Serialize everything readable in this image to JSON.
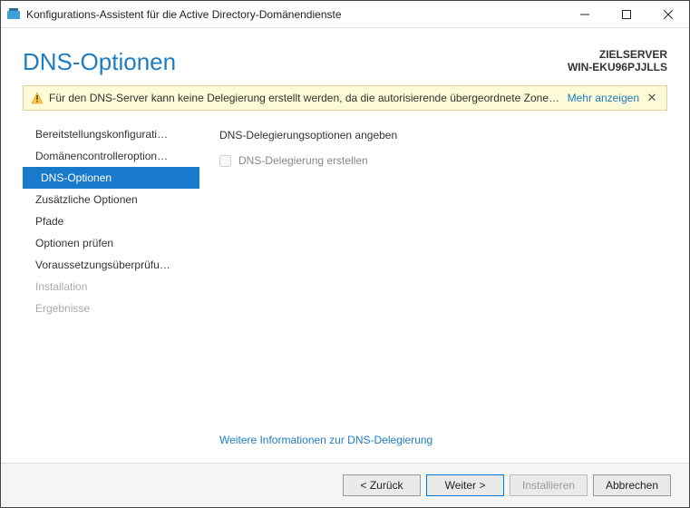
{
  "window": {
    "title": "Konfigurations-Assistent für die Active Directory-Domänendienste"
  },
  "header": {
    "page_title": "DNS-Optionen",
    "target_label": "ZIELSERVER",
    "target_name": "WIN-EKU96PJJLLS"
  },
  "warning": {
    "message": "Für den DNS-Server kann keine Delegierung erstellt werden, da die autorisierende übergeordnete Zone…",
    "more": "Mehr anzeigen"
  },
  "nav": {
    "items": [
      {
        "label": "Bereitstellungskonfigurati…",
        "state": "normal"
      },
      {
        "label": "Domänencontrolleroption…",
        "state": "normal"
      },
      {
        "label": "DNS-Optionen",
        "state": "selected"
      },
      {
        "label": "Zusätzliche Optionen",
        "state": "normal"
      },
      {
        "label": "Pfade",
        "state": "normal"
      },
      {
        "label": "Optionen prüfen",
        "state": "normal"
      },
      {
        "label": "Voraussetzungsüberprüfu…",
        "state": "normal"
      },
      {
        "label": "Installation",
        "state": "disabled"
      },
      {
        "label": "Ergebnisse",
        "state": "disabled"
      }
    ]
  },
  "content": {
    "section_title": "DNS-Delegierungsoptionen angeben",
    "checkbox_label": "DNS-Delegierung erstellen",
    "checkbox_checked": false,
    "more_link": "Weitere Informationen zur DNS-Delegierung"
  },
  "footer": {
    "back": "< Zurück",
    "next": "Weiter >",
    "install": "Installieren",
    "cancel": "Abbrechen"
  }
}
